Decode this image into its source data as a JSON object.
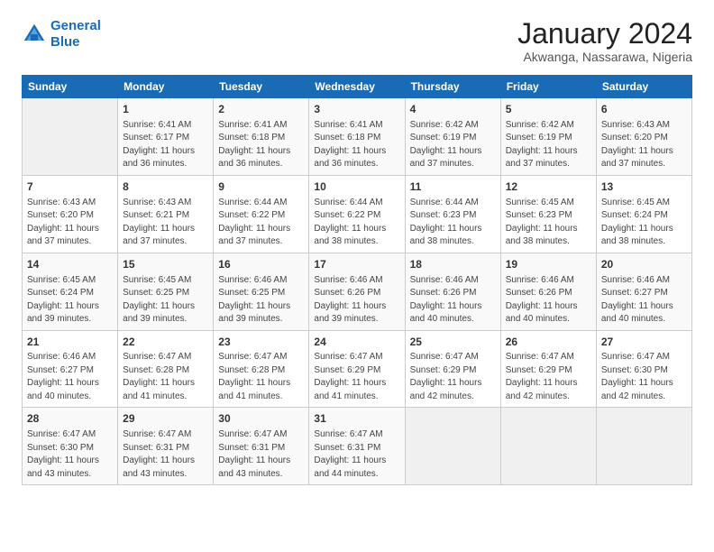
{
  "logo": {
    "line1": "General",
    "line2": "Blue"
  },
  "header": {
    "month_year": "January 2024",
    "location": "Akwanga, Nassarawa, Nigeria"
  },
  "days_of_week": [
    "Sunday",
    "Monday",
    "Tuesday",
    "Wednesday",
    "Thursday",
    "Friday",
    "Saturday"
  ],
  "weeks": [
    [
      {
        "day": "",
        "sunrise": "",
        "sunset": "",
        "daylight": ""
      },
      {
        "day": "1",
        "sunrise": "Sunrise: 6:41 AM",
        "sunset": "Sunset: 6:17 PM",
        "daylight": "Daylight: 11 hours and 36 minutes."
      },
      {
        "day": "2",
        "sunrise": "Sunrise: 6:41 AM",
        "sunset": "Sunset: 6:18 PM",
        "daylight": "Daylight: 11 hours and 36 minutes."
      },
      {
        "day": "3",
        "sunrise": "Sunrise: 6:41 AM",
        "sunset": "Sunset: 6:18 PM",
        "daylight": "Daylight: 11 hours and 36 minutes."
      },
      {
        "day": "4",
        "sunrise": "Sunrise: 6:42 AM",
        "sunset": "Sunset: 6:19 PM",
        "daylight": "Daylight: 11 hours and 37 minutes."
      },
      {
        "day": "5",
        "sunrise": "Sunrise: 6:42 AM",
        "sunset": "Sunset: 6:19 PM",
        "daylight": "Daylight: 11 hours and 37 minutes."
      },
      {
        "day": "6",
        "sunrise": "Sunrise: 6:43 AM",
        "sunset": "Sunset: 6:20 PM",
        "daylight": "Daylight: 11 hours and 37 minutes."
      }
    ],
    [
      {
        "day": "7",
        "sunrise": "Sunrise: 6:43 AM",
        "sunset": "Sunset: 6:20 PM",
        "daylight": "Daylight: 11 hours and 37 minutes."
      },
      {
        "day": "8",
        "sunrise": "Sunrise: 6:43 AM",
        "sunset": "Sunset: 6:21 PM",
        "daylight": "Daylight: 11 hours and 37 minutes."
      },
      {
        "day": "9",
        "sunrise": "Sunrise: 6:44 AM",
        "sunset": "Sunset: 6:22 PM",
        "daylight": "Daylight: 11 hours and 37 minutes."
      },
      {
        "day": "10",
        "sunrise": "Sunrise: 6:44 AM",
        "sunset": "Sunset: 6:22 PM",
        "daylight": "Daylight: 11 hours and 38 minutes."
      },
      {
        "day": "11",
        "sunrise": "Sunrise: 6:44 AM",
        "sunset": "Sunset: 6:23 PM",
        "daylight": "Daylight: 11 hours and 38 minutes."
      },
      {
        "day": "12",
        "sunrise": "Sunrise: 6:45 AM",
        "sunset": "Sunset: 6:23 PM",
        "daylight": "Daylight: 11 hours and 38 minutes."
      },
      {
        "day": "13",
        "sunrise": "Sunrise: 6:45 AM",
        "sunset": "Sunset: 6:24 PM",
        "daylight": "Daylight: 11 hours and 38 minutes."
      }
    ],
    [
      {
        "day": "14",
        "sunrise": "Sunrise: 6:45 AM",
        "sunset": "Sunset: 6:24 PM",
        "daylight": "Daylight: 11 hours and 39 minutes."
      },
      {
        "day": "15",
        "sunrise": "Sunrise: 6:45 AM",
        "sunset": "Sunset: 6:25 PM",
        "daylight": "Daylight: 11 hours and 39 minutes."
      },
      {
        "day": "16",
        "sunrise": "Sunrise: 6:46 AM",
        "sunset": "Sunset: 6:25 PM",
        "daylight": "Daylight: 11 hours and 39 minutes."
      },
      {
        "day": "17",
        "sunrise": "Sunrise: 6:46 AM",
        "sunset": "Sunset: 6:26 PM",
        "daylight": "Daylight: 11 hours and 39 minutes."
      },
      {
        "day": "18",
        "sunrise": "Sunrise: 6:46 AM",
        "sunset": "Sunset: 6:26 PM",
        "daylight": "Daylight: 11 hours and 40 minutes."
      },
      {
        "day": "19",
        "sunrise": "Sunrise: 6:46 AM",
        "sunset": "Sunset: 6:26 PM",
        "daylight": "Daylight: 11 hours and 40 minutes."
      },
      {
        "day": "20",
        "sunrise": "Sunrise: 6:46 AM",
        "sunset": "Sunset: 6:27 PM",
        "daylight": "Daylight: 11 hours and 40 minutes."
      }
    ],
    [
      {
        "day": "21",
        "sunrise": "Sunrise: 6:46 AM",
        "sunset": "Sunset: 6:27 PM",
        "daylight": "Daylight: 11 hours and 40 minutes."
      },
      {
        "day": "22",
        "sunrise": "Sunrise: 6:47 AM",
        "sunset": "Sunset: 6:28 PM",
        "daylight": "Daylight: 11 hours and 41 minutes."
      },
      {
        "day": "23",
        "sunrise": "Sunrise: 6:47 AM",
        "sunset": "Sunset: 6:28 PM",
        "daylight": "Daylight: 11 hours and 41 minutes."
      },
      {
        "day": "24",
        "sunrise": "Sunrise: 6:47 AM",
        "sunset": "Sunset: 6:29 PM",
        "daylight": "Daylight: 11 hours and 41 minutes."
      },
      {
        "day": "25",
        "sunrise": "Sunrise: 6:47 AM",
        "sunset": "Sunset: 6:29 PM",
        "daylight": "Daylight: 11 hours and 42 minutes."
      },
      {
        "day": "26",
        "sunrise": "Sunrise: 6:47 AM",
        "sunset": "Sunset: 6:29 PM",
        "daylight": "Daylight: 11 hours and 42 minutes."
      },
      {
        "day": "27",
        "sunrise": "Sunrise: 6:47 AM",
        "sunset": "Sunset: 6:30 PM",
        "daylight": "Daylight: 11 hours and 42 minutes."
      }
    ],
    [
      {
        "day": "28",
        "sunrise": "Sunrise: 6:47 AM",
        "sunset": "Sunset: 6:30 PM",
        "daylight": "Daylight: 11 hours and 43 minutes."
      },
      {
        "day": "29",
        "sunrise": "Sunrise: 6:47 AM",
        "sunset": "Sunset: 6:31 PM",
        "daylight": "Daylight: 11 hours and 43 minutes."
      },
      {
        "day": "30",
        "sunrise": "Sunrise: 6:47 AM",
        "sunset": "Sunset: 6:31 PM",
        "daylight": "Daylight: 11 hours and 43 minutes."
      },
      {
        "day": "31",
        "sunrise": "Sunrise: 6:47 AM",
        "sunset": "Sunset: 6:31 PM",
        "daylight": "Daylight: 11 hours and 44 minutes."
      },
      {
        "day": "",
        "sunrise": "",
        "sunset": "",
        "daylight": ""
      },
      {
        "day": "",
        "sunrise": "",
        "sunset": "",
        "daylight": ""
      },
      {
        "day": "",
        "sunrise": "",
        "sunset": "",
        "daylight": ""
      }
    ]
  ]
}
